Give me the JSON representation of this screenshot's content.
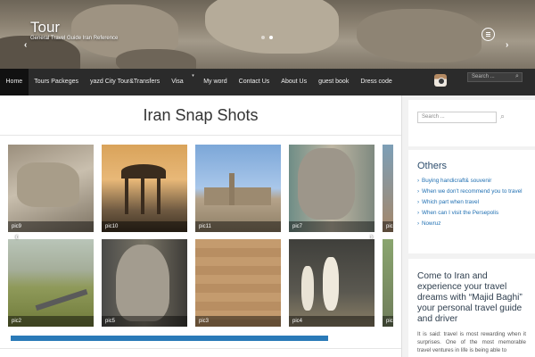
{
  "header": {
    "site_title": "Tour",
    "tagline": "General Travel Guide Iran Reference",
    "prev_arrow": "‹",
    "next_arrow": "›"
  },
  "nav": {
    "items": [
      {
        "label": "Home",
        "active": true
      },
      {
        "label": "Tours Packeges"
      },
      {
        "label": "yazd City Tour&Transfers"
      },
      {
        "label": "Visa",
        "has_submenu": true
      },
      {
        "label": "My word"
      },
      {
        "label": "Contact Us"
      },
      {
        "label": "About Us"
      },
      {
        "label": "guest book"
      },
      {
        "label": "Dress code"
      }
    ],
    "search_placeholder": "Search ...",
    "submenu_caret": "▾",
    "search_icon_glyph": "⌕"
  },
  "main": {
    "page_title": "Iran Snap Shots",
    "gallery": {
      "row1": [
        "pic9",
        "pic10",
        "pic11",
        "pic7",
        "pic"
      ],
      "row2": [
        "pic2",
        "pic5",
        "pic3",
        "pic4",
        "pic"
      ],
      "prev_arrow": "‹",
      "next_arrow": "›"
    }
  },
  "sidebar": {
    "search_placeholder": "Search ...",
    "search_icon_glyph": "⌕",
    "others_title": "Others",
    "others_links": [
      "Buying handicraft& souvenir",
      "When we don't recommend you to travel",
      "Which part when travel",
      "When can I visit the Persepolis",
      "Nowruz"
    ],
    "promo_heading": "Come to Iran and experience your travel dreams with “Majid Baghi” your personal travel guide and driver",
    "promo_text": "It is said: travel is most rewarding when it surprises. One of the most memorable travel ventures in life is being able to"
  },
  "colors": {
    "nav_bg": "#2b2b2b",
    "link": "#1f6fb2",
    "progress": "#2a7ab8"
  }
}
